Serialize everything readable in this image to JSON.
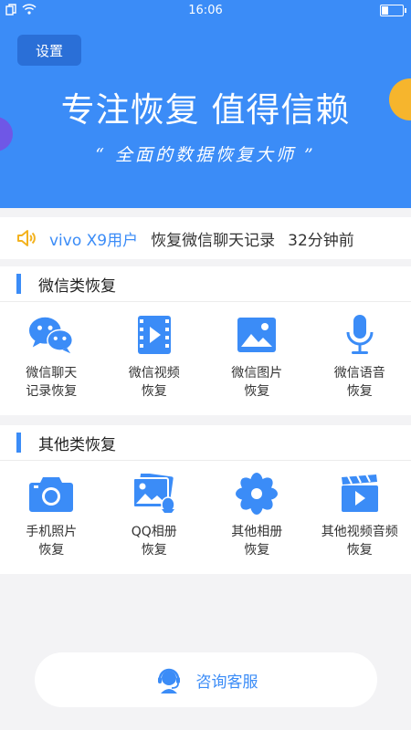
{
  "status_bar": {
    "time": "16:06"
  },
  "hero": {
    "settings_label": "设置",
    "title": "专注恢复 值得信赖",
    "subtitle": "“ 全面的数据恢复大师 ”"
  },
  "notice": {
    "user": "vivo X9用户",
    "message": "恢复微信聊天记录",
    "time_ago": "32分钟前"
  },
  "sections": [
    {
      "title": "微信类恢复",
      "items": [
        {
          "label": "微信聊天\n记录恢复",
          "icon": "wechat-chat-icon"
        },
        {
          "label": "微信视频\n恢复",
          "icon": "video-icon"
        },
        {
          "label": "微信图片\n恢复",
          "icon": "image-icon"
        },
        {
          "label": "微信语音\n恢复",
          "icon": "microphone-icon"
        }
      ]
    },
    {
      "title": "其他类恢复",
      "items": [
        {
          "label": "手机照片\n恢复",
          "icon": "camera-icon"
        },
        {
          "label": "QQ相册\n恢复",
          "icon": "qq-album-icon"
        },
        {
          "label": "其他相册\n恢复",
          "icon": "flower-album-icon"
        },
        {
          "label": "其他视频音频\n恢复",
          "icon": "video-audio-icon"
        }
      ]
    }
  ],
  "service": {
    "label": "咨询客服",
    "icon": "customer-service-icon"
  },
  "colors": {
    "primary": "#3b8cf7",
    "settings_bg": "#2a6fd7",
    "accent_orange": "#f6b52d",
    "accent_purple": "#6f57e6",
    "speaker": "#f3b21f"
  }
}
